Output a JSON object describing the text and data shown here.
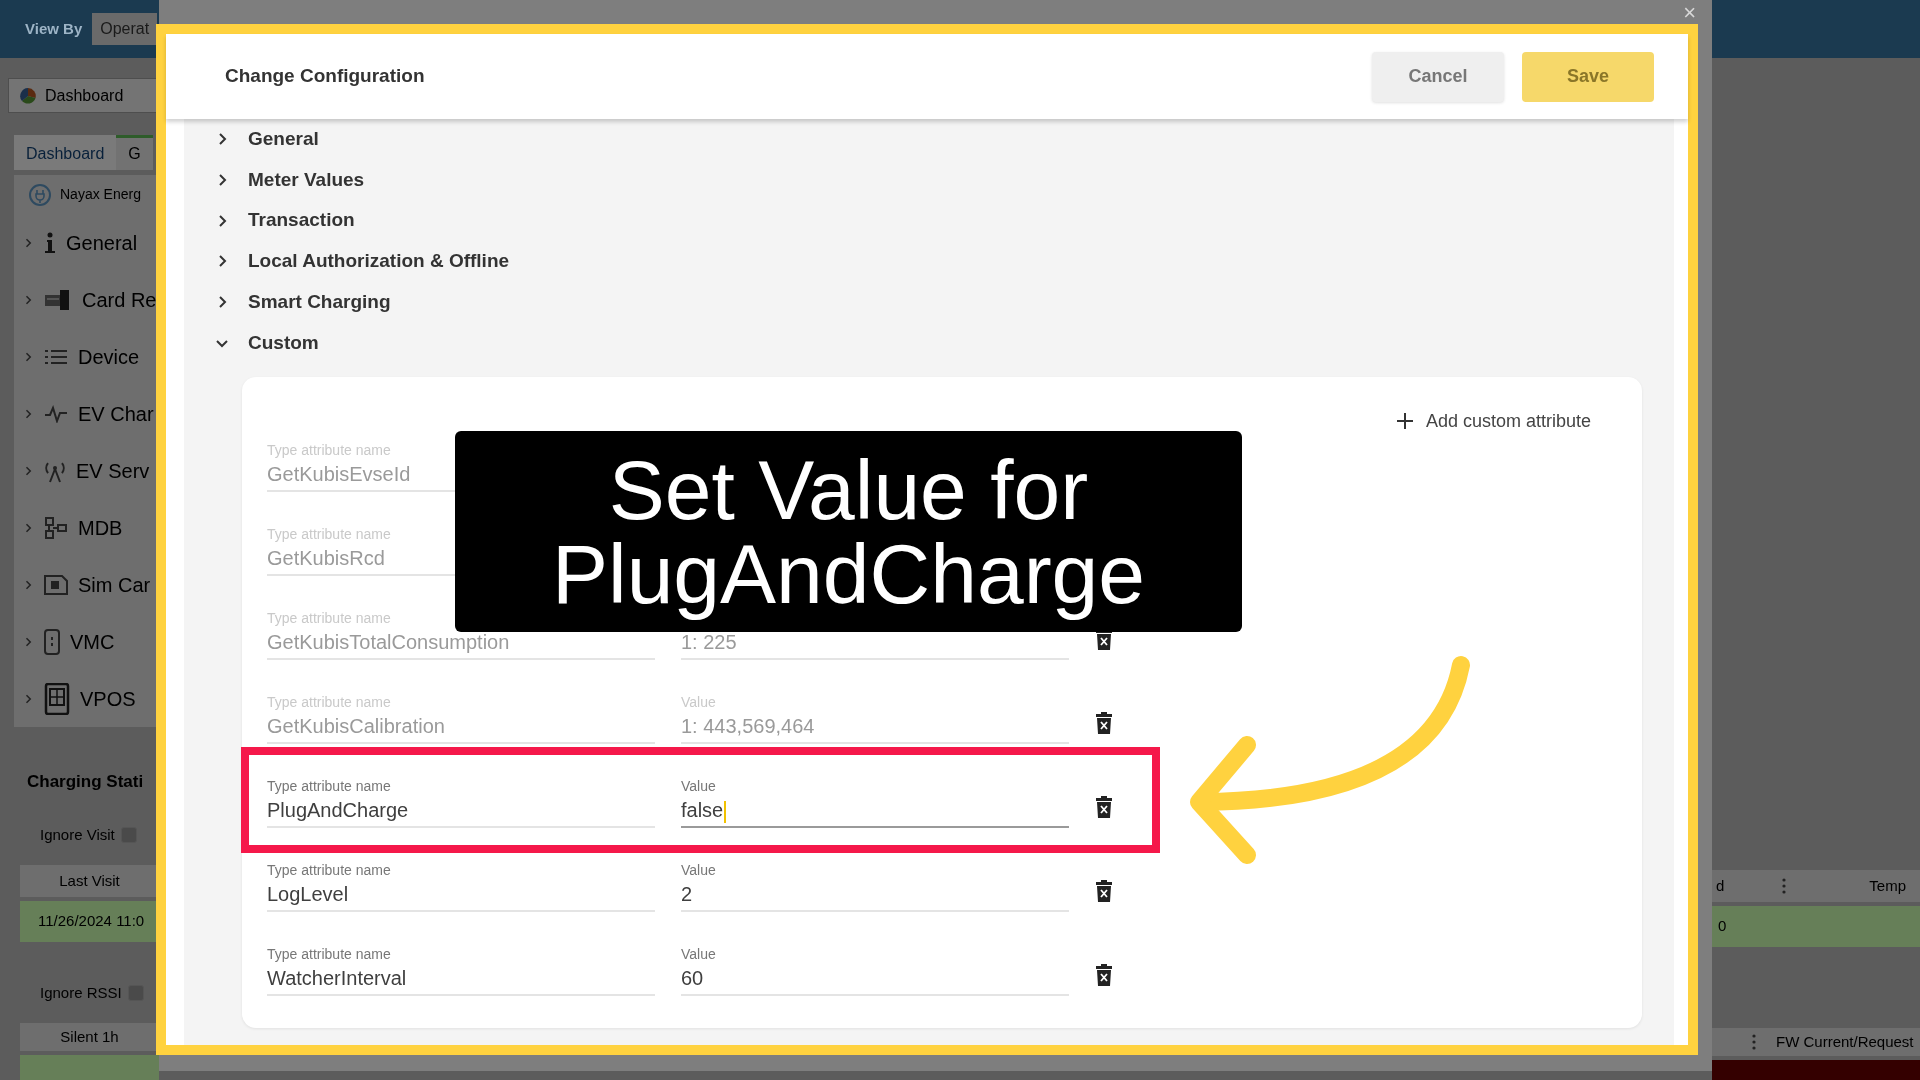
{
  "app": {
    "top_bar": {
      "label": "View By",
      "view_select": "Operat"
    },
    "dashboard_select": "Dashboard",
    "tabs": [
      {
        "label": "Dashboard",
        "selected": false
      },
      {
        "label": "G",
        "selected": true
      }
    ],
    "device_name": "Nayax Energ",
    "tree": [
      {
        "label": "General",
        "expanded": false
      },
      {
        "label": "Card Re",
        "expanded": false
      },
      {
        "label": "Device",
        "expanded": false
      },
      {
        "label": "EV Char",
        "expanded": false
      },
      {
        "label": "EV Serv",
        "expanded": false
      },
      {
        "label": "MDB",
        "expanded": false
      },
      {
        "label": "Sim Car",
        "expanded": false
      },
      {
        "label": "VMC",
        "expanded": false
      },
      {
        "label": "VPOS",
        "expanded": false
      }
    ],
    "section_title": "Charging Stati",
    "left_blocks": [
      {
        "filter": "Ignore Visit",
        "checked": false,
        "column": "Last Visit",
        "cell": "11/26/2024 11:0"
      },
      {
        "filter": "Ignore RSSI",
        "checked": false,
        "column": "Silent 1h"
      }
    ],
    "right_blocks": [
      {
        "columns": [
          "d",
          "Temp"
        ],
        "cells": [
          "0",
          ""
        ]
      },
      {
        "columns": [
          "",
          "FW Current/Request"
        ]
      }
    ]
  },
  "dialog": {
    "close": "×",
    "title": "Change Configuration",
    "buttons": [
      {
        "label": "Cancel",
        "kind": "secondary"
      },
      {
        "label": "Save",
        "kind": "primary"
      }
    ],
    "sections": [
      {
        "label": "General",
        "expanded": false
      },
      {
        "label": "Meter Values",
        "expanded": false
      },
      {
        "label": "Transaction",
        "expanded": false
      },
      {
        "label": "Local Authorization & Offline",
        "expanded": false
      },
      {
        "label": "Smart Charging",
        "expanded": false
      },
      {
        "label": "Custom",
        "expanded": true
      }
    ],
    "custom": {
      "add_label": "Add custom attribute",
      "attributes": [
        {
          "name_label": "Type attribute name",
          "name": "GetKubisEvseId",
          "disabled": true,
          "focused": false
        },
        {
          "name_label": "Type attribute name",
          "name": "GetKubisRcd",
          "disabled": true,
          "focused": false
        },
        {
          "name_label": "Type attribute name",
          "name": "GetKubisTotalConsumption",
          "value": "1: 225",
          "disabled": true,
          "focused": false
        },
        {
          "name_label": "Type attribute name",
          "name": "GetKubisCalibration",
          "value_label": "Value",
          "value": "1: 443,569,464",
          "disabled": true,
          "focused": false
        },
        {
          "name_label": "Type attribute name",
          "name": "PlugAndCharge",
          "value_label": "Value",
          "value": "false",
          "disabled": false,
          "focused": true
        },
        {
          "name_label": "Type attribute name",
          "name": "LogLevel",
          "value_label": "Value",
          "value": "2",
          "disabled": false,
          "focused": false
        },
        {
          "name_label": "Type attribute name",
          "name": "WatcherInterval",
          "value_label": "Value",
          "value": "60",
          "disabled": false,
          "focused": false
        }
      ]
    }
  },
  "callout": {
    "lines": [
      "Set Value for",
      "PlugAndCharge"
    ]
  }
}
